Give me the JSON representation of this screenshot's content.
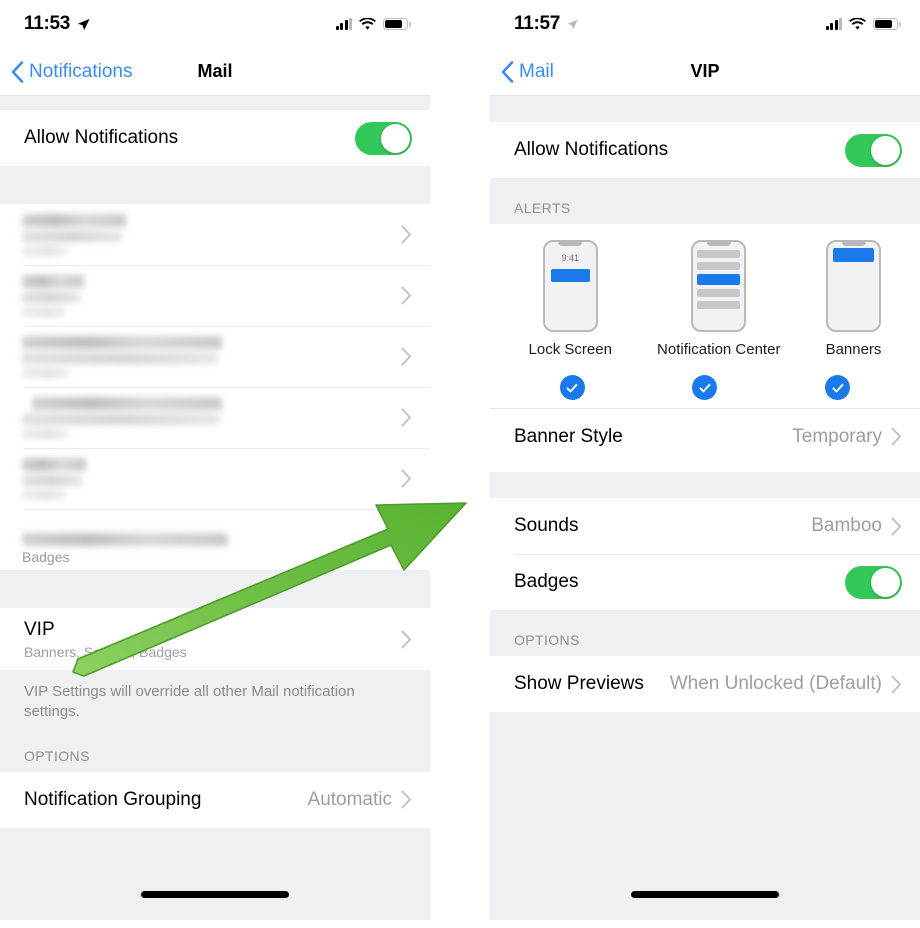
{
  "left_screen": {
    "status": {
      "time": "11:53",
      "location_icon": "location-arrow-icon",
      "signal_icon": "cellular-signal-icon",
      "wifi_icon": "wifi-icon",
      "battery_icon": "battery-icon"
    },
    "nav": {
      "back_label": "Notifications",
      "title": "Mail"
    },
    "allow_row": {
      "label": "Allow Notifications",
      "toggle_state": "on"
    },
    "blurred_rows": [
      {
        "name": "blurred-setting-row-1"
      },
      {
        "name": "blurred-setting-row-2"
      },
      {
        "name": "blurred-setting-row-3"
      },
      {
        "name": "blurred-setting-row-4"
      },
      {
        "name": "blurred-setting-row-5"
      },
      {
        "name": "blurred-setting-row-6"
      }
    ],
    "badges_peek_label": "Badges",
    "vip_row": {
      "label": "VIP",
      "sublabel": "Banners, Sounds, Badges"
    },
    "vip_footer": "VIP Settings will override all other Mail notification settings.",
    "options_header": "OPTIONS",
    "grouping_row": {
      "label": "Notification Grouping",
      "value": "Automatic"
    }
  },
  "right_screen": {
    "status": {
      "time": "11:57",
      "location_icon": "location-arrow-icon",
      "signal_icon": "cellular-signal-icon",
      "wifi_icon": "wifi-icon",
      "battery_icon": "battery-icon"
    },
    "nav": {
      "back_label": "Mail",
      "title": "VIP"
    },
    "allow_row": {
      "label": "Allow Notifications",
      "toggle_state": "on"
    },
    "alerts_header": "ALERTS",
    "alert_styles": [
      {
        "label": "Lock Screen",
        "mock_time": "9:41",
        "selected": true
      },
      {
        "label": "Notification Center",
        "selected": true
      },
      {
        "label": "Banners",
        "selected": true
      }
    ],
    "banner_style_row": {
      "label": "Banner Style",
      "value": "Temporary"
    },
    "sounds_row": {
      "label": "Sounds",
      "value": "Bamboo"
    },
    "badges_row": {
      "label": "Badges",
      "toggle_state": "on"
    },
    "options_header": "OPTIONS",
    "previews_row": {
      "label": "Show Previews",
      "value": "When Unlocked (Default)"
    }
  },
  "annotation": {
    "arrow_color": "#6cbe45",
    "arrow_edge": "#4e9c2e"
  },
  "colors": {
    "accent_blue": "#3a8bf5",
    "toggle_green": "#34c759",
    "check_blue": "#1a7aeb",
    "page_bg": "#eff0f4"
  }
}
